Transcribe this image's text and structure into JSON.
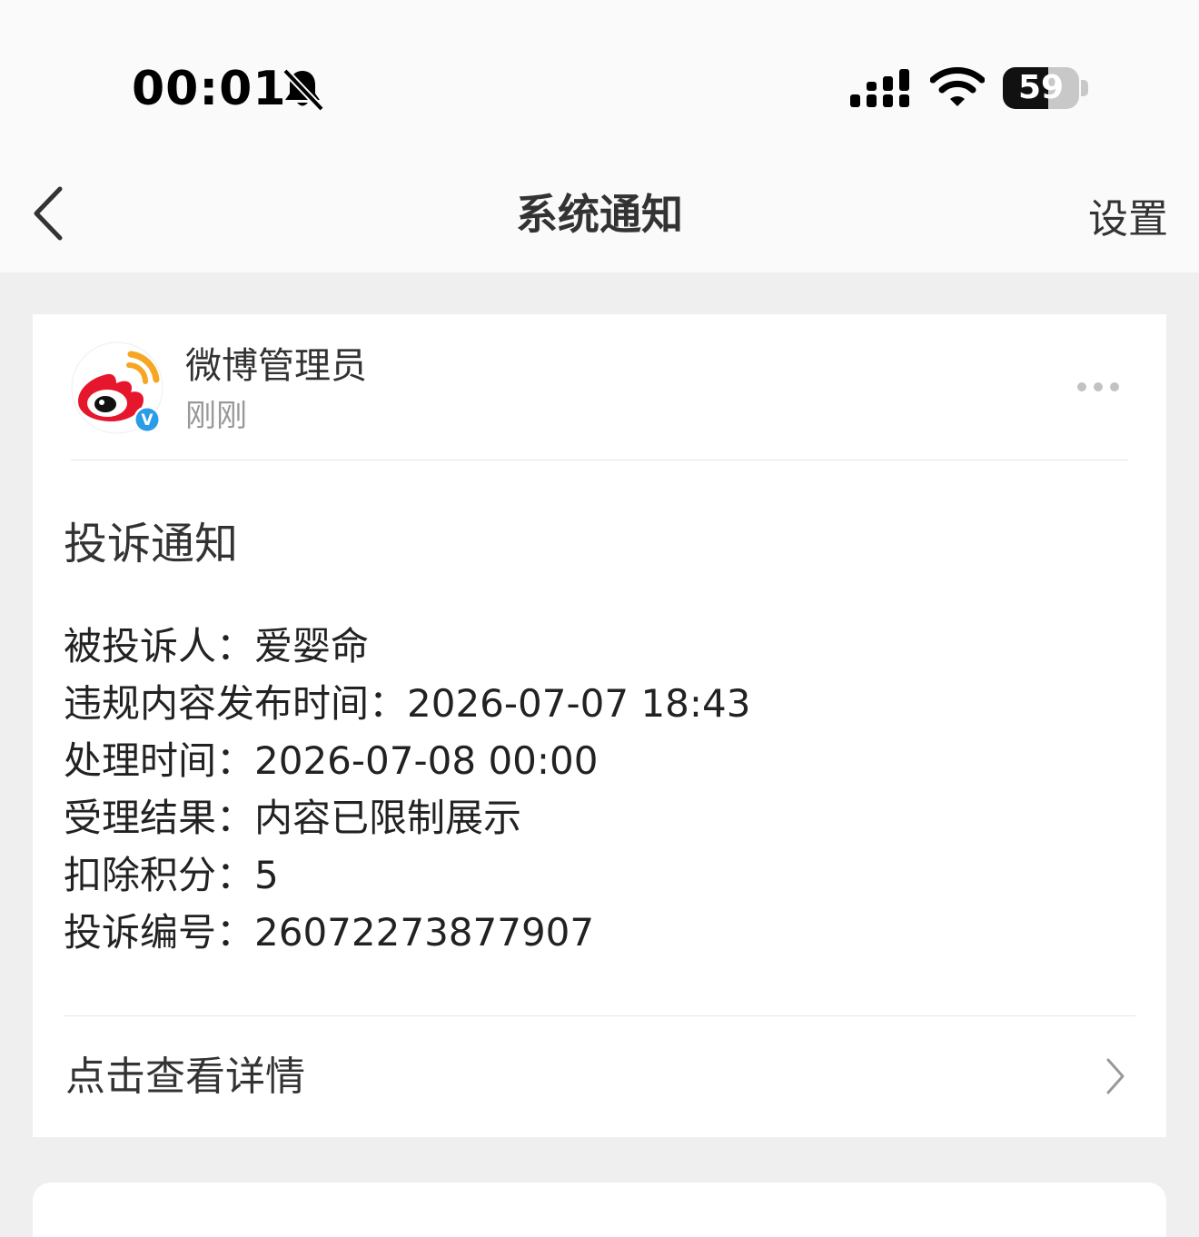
{
  "status_bar": {
    "time": "00:01",
    "battery_level": "59",
    "battery_fraction": 0.59,
    "icons": [
      "bell-slash-icon",
      "cellular-signal-icon",
      "wifi-icon",
      "battery-icon"
    ]
  },
  "nav": {
    "back_icon": "chevron-left-icon",
    "title": "系统通知",
    "settings_label": "设置"
  },
  "message": {
    "sender_name": "微博管理员",
    "time_label": "刚刚",
    "avatar_icon": "weibo-logo-icon",
    "verified_badge": "V",
    "verified_color": "#2a9ce8",
    "more_icon": "more-dots-icon",
    "notice_title": "投诉通知",
    "details": [
      {
        "label": "被投诉人：",
        "value": "爱婴命"
      },
      {
        "label": "违规内容发布时间：",
        "value": "2026-07-07 18:43"
      },
      {
        "label": "处理时间：",
        "value": "2026-07-08 00:00"
      },
      {
        "label": "受理结果：",
        "value": "内容已限制展示"
      },
      {
        "label": "扣除积分：",
        "value": "5"
      },
      {
        "label": "投诉编号：",
        "value": "26072273877907"
      }
    ],
    "view_details_label": "点击查看详情",
    "chevron_icon": "chevron-right-icon"
  },
  "colors": {
    "page_background": "#efefef",
    "card_background": "#ffffff",
    "weibo_red": "#e6162d",
    "weibo_orange": "#f5a623"
  }
}
